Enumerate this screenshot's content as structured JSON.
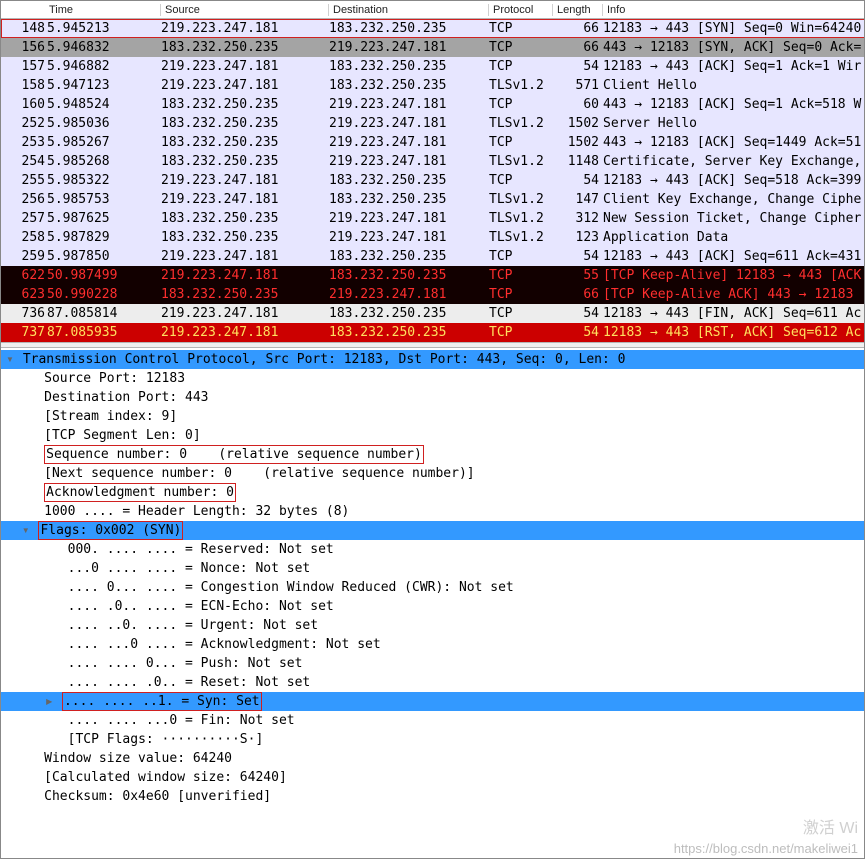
{
  "columns": {
    "no": "",
    "time": "Time",
    "source": "Source",
    "dest": "Destination",
    "proto": "Protocol",
    "len": "Length",
    "info": "Info"
  },
  "packets": [
    {
      "cls": "redbox outline-red",
      "no": "148",
      "time": "5.945213",
      "source": "219.223.247.181",
      "dest": "183.232.250.235",
      "proto": "TCP",
      "len": "66",
      "info": "12183 → 443 [SYN] Seq=0 Win=64240"
    },
    {
      "cls": "grey",
      "no": "156",
      "time": "5.946832",
      "source": "183.232.250.235",
      "dest": "219.223.247.181",
      "proto": "TCP",
      "len": "66",
      "info": "443 → 12183 [SYN, ACK] Seq=0 Ack="
    },
    {
      "cls": "normal",
      "no": "157",
      "time": "5.946882",
      "source": "219.223.247.181",
      "dest": "183.232.250.235",
      "proto": "TCP",
      "len": "54",
      "info": "12183 → 443 [ACK] Seq=1 Ack=1 Wir"
    },
    {
      "cls": "normal",
      "no": "158",
      "time": "5.947123",
      "source": "219.223.247.181",
      "dest": "183.232.250.235",
      "proto": "TLSv1.2",
      "len": "571",
      "info": "Client Hello"
    },
    {
      "cls": "normal",
      "no": "160",
      "time": "5.948524",
      "source": "183.232.250.235",
      "dest": "219.223.247.181",
      "proto": "TCP",
      "len": "60",
      "info": "443 → 12183 [ACK] Seq=1 Ack=518 W"
    },
    {
      "cls": "normal",
      "no": "252",
      "time": "5.985036",
      "source": "183.232.250.235",
      "dest": "219.223.247.181",
      "proto": "TLSv1.2",
      "len": "1502",
      "info": "Server Hello"
    },
    {
      "cls": "normal",
      "no": "253",
      "time": "5.985267",
      "source": "183.232.250.235",
      "dest": "219.223.247.181",
      "proto": "TCP",
      "len": "1502",
      "info": "443 → 12183 [ACK] Seq=1449 Ack=51"
    },
    {
      "cls": "normal",
      "no": "254",
      "time": "5.985268",
      "source": "183.232.250.235",
      "dest": "219.223.247.181",
      "proto": "TLSv1.2",
      "len": "1148",
      "info": "Certificate, Server Key Exchange,"
    },
    {
      "cls": "normal",
      "no": "255",
      "time": "5.985322",
      "source": "219.223.247.181",
      "dest": "183.232.250.235",
      "proto": "TCP",
      "len": "54",
      "info": "12183 → 443 [ACK] Seq=518 Ack=399"
    },
    {
      "cls": "normal",
      "no": "256",
      "time": "5.985753",
      "source": "219.223.247.181",
      "dest": "183.232.250.235",
      "proto": "TLSv1.2",
      "len": "147",
      "info": "Client Key Exchange, Change Ciphe"
    },
    {
      "cls": "normal",
      "no": "257",
      "time": "5.987625",
      "source": "183.232.250.235",
      "dest": "219.223.247.181",
      "proto": "TLSv1.2",
      "len": "312",
      "info": "New Session Ticket, Change Cipher"
    },
    {
      "cls": "normal",
      "no": "258",
      "time": "5.987829",
      "source": "183.232.250.235",
      "dest": "219.223.247.181",
      "proto": "TLSv1.2",
      "len": "123",
      "info": "Application Data"
    },
    {
      "cls": "normal",
      "no": "259",
      "time": "5.987850",
      "source": "219.223.247.181",
      "dest": "183.232.250.235",
      "proto": "TCP",
      "len": "54",
      "info": "12183 → 443 [ACK] Seq=611 Ack=431"
    },
    {
      "cls": "black",
      "no": "622",
      "time": "50.987499",
      "source": "219.223.247.181",
      "dest": "183.232.250.235",
      "proto": "TCP",
      "len": "55",
      "info": "[TCP Keep-Alive] 12183 → 443 [ACK"
    },
    {
      "cls": "black",
      "no": "623",
      "time": "50.990228",
      "source": "183.232.250.235",
      "dest": "219.223.247.181",
      "proto": "TCP",
      "len": "66",
      "info": "[TCP Keep-Alive ACK] 443 → 12183 "
    },
    {
      "cls": "lightgrey",
      "no": "736",
      "time": "87.085814",
      "source": "219.223.247.181",
      "dest": "183.232.250.235",
      "proto": "TCP",
      "len": "54",
      "info": "12183 → 443 [FIN, ACK] Seq=611 Ac"
    },
    {
      "cls": "red",
      "no": "737",
      "time": "87.085935",
      "source": "219.223.247.181",
      "dest": "183.232.250.235",
      "proto": "TCP",
      "len": "54",
      "info": "12183 → 443 [RST, ACK] Seq=612 Ac"
    }
  ],
  "detail": {
    "root": "Transmission Control Protocol, Src Port: 12183, Dst Port: 443, Seq: 0, Len: 0",
    "srcport": "Source Port: 12183",
    "dstport": "Destination Port: 443",
    "stream": "[Stream index: 9]",
    "seglen": "[TCP Segment Len: 0]",
    "seq": "Sequence number: 0    (relative sequence number)",
    "nextseq": "[Next sequence number: 0    (relative sequence number)]",
    "ack": "Acknowledgment number: 0",
    "hdrlen": "1000 .... = Header Length: 32 bytes (8)",
    "flags_hdr": "Flags: 0x002 (SYN)",
    "flags": {
      "res": "000. .... .... = Reserved: Not set",
      "nonce": "...0 .... .... = Nonce: Not set",
      "cwr": ".... 0... .... = Congestion Window Reduced (CWR): Not set",
      "ecn": ".... .0.. .... = ECN-Echo: Not set",
      "urg": ".... ..0. .... = Urgent: Not set",
      "ackf": ".... ...0 .... = Acknowledgment: Not set",
      "psh": ".... .... 0... = Push: Not set",
      "rst": ".... .... .0.. = Reset: Not set",
      "syn": ".... .... ..1. = Syn: Set",
      "fin": ".... .... ...0 = Fin: Not set",
      "str": "[TCP Flags: ··········S·]"
    },
    "win": "Window size value: 64240",
    "cwin": "[Calculated window size: 64240]",
    "cksum": "Checksum: 0x4e60 [unverified]"
  },
  "watermark": "https://blog.csdn.net/makeliwei1",
  "watermark2": "激活 Wi"
}
